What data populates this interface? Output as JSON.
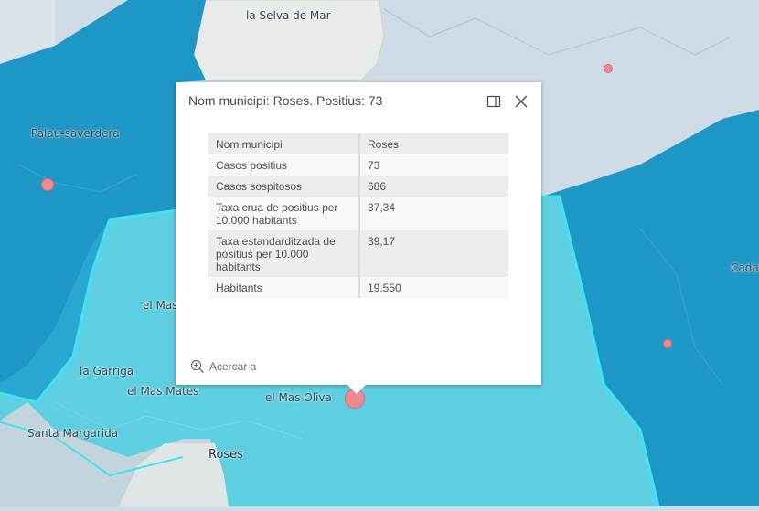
{
  "map": {
    "colors": {
      "land_light": "#cfdbe6",
      "land_grey": "#e7ecea",
      "choropleth_dark": "#1f97c6",
      "choropleth_mid": "#2aa6d2",
      "choropleth_light": "#5ecfe0",
      "selected_outline": "#41e3f0",
      "marker": "#f08a91"
    },
    "labels": {
      "selva_de_mar": "la Selva de Mar",
      "palau_saverdera": "Palau-saverdera",
      "el_mas_1": "el Mas",
      "la_garriga": "la Garriga",
      "el_mas_mates": "el Mas Mates",
      "el_mas_oliva": "el Mas Oliva",
      "santa_margarida": "Santa Margarida",
      "roses": "Roses",
      "cadaques_partial": "Cadar"
    }
  },
  "popup": {
    "title": "Nom municipi: Roses. Positius: 73",
    "rows": [
      {
        "key": "Nom municipi",
        "value": "Roses"
      },
      {
        "key": "Casos positius",
        "value": "73"
      },
      {
        "key": "Casos sospitosos",
        "value": "686"
      },
      {
        "key": "Taxa crua de positius per 10.000 habitants",
        "value": "37,34"
      },
      {
        "key": "Taxa estandarditzada de positius per 10.000 habitants",
        "value": "39,17"
      },
      {
        "key": "Habitants",
        "value": "19.550"
      }
    ],
    "zoom_label": "Acercar a",
    "icons": {
      "dock": "dock-icon",
      "close": "close-icon",
      "zoom": "zoom-in-icon"
    }
  }
}
